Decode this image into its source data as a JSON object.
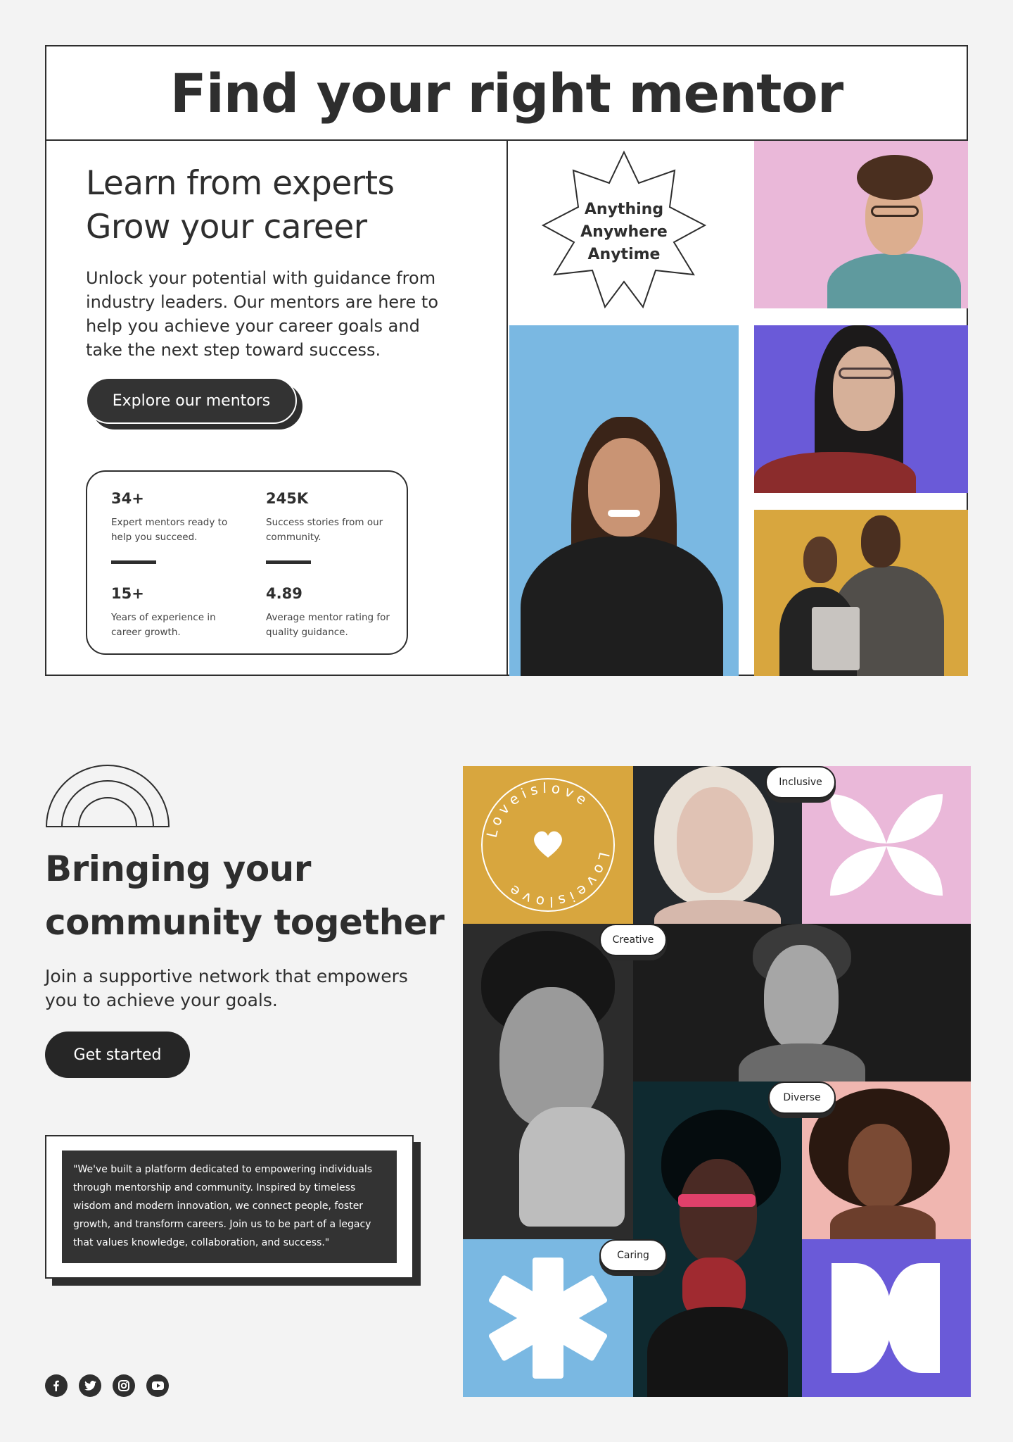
{
  "hero": {
    "title": "Find your right mentor",
    "headline_line1": "Learn from experts",
    "headline_line2": "Grow your career",
    "intro": "Unlock your potential with guidance from industry leaders. Our mentors are here to help you achieve your career goals and take the next step toward success.",
    "cta_label": "Explore our mentors",
    "badge_lines": [
      "Anything",
      "Anywhere",
      "Anytime"
    ],
    "stats": [
      {
        "value": "34+",
        "desc": "Expert mentors ready to help you succeed."
      },
      {
        "value": "245K",
        "desc": "Success stories from our community."
      },
      {
        "value": "15+",
        "desc": "Years of experience in career growth."
      },
      {
        "value": "4.89",
        "desc": "Average mentor rating for quality guidance."
      }
    ]
  },
  "community": {
    "title_line1": "Bringing your",
    "title_line2": "community together",
    "lead": "Join a supportive network that empowers you to achieve your goals.",
    "cta_label": "Get started",
    "quote": "\"We've built a platform dedicated to empowering individuals through mentorship and community. Inspired by timeless wisdom and modern innovation, we connect people, foster growth, and transform careers. Join us to be part of a legacy that values knowledge, collaboration, and success.\"",
    "stamp_text": "Loveislove",
    "tags": [
      "Inclusive",
      "Creative",
      "Diverse",
      "Caring"
    ]
  },
  "socials": [
    "facebook-icon",
    "twitter-icon",
    "instagram-icon",
    "youtube-icon"
  ],
  "colors": {
    "ink": "#2e2e2e",
    "pink": "#eab8d9",
    "purple": "#6a5ad8",
    "sky": "#7ab8e2",
    "mustard": "#d8a63e"
  }
}
